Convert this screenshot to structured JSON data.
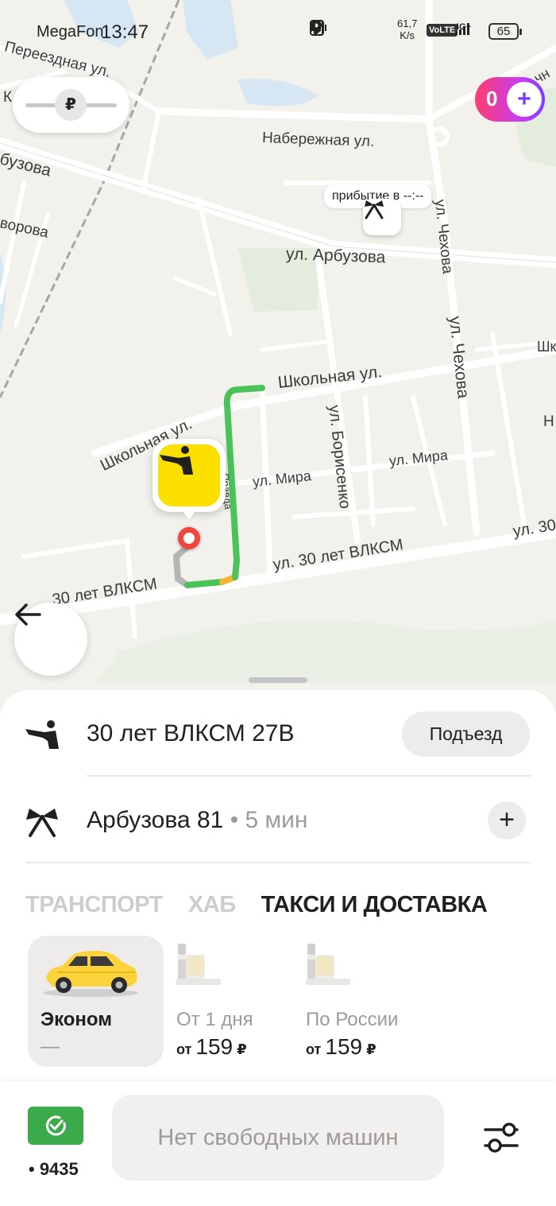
{
  "status_bar": {
    "carrier": "MegaFon",
    "time": "13:47",
    "speed_value": "61,7",
    "speed_unit": "K/s",
    "volte": "VoLTE",
    "network": "4G+",
    "battery": "65"
  },
  "map": {
    "price_toggle_symbol": "₽",
    "plus_count": "0",
    "arrival_text": "прибытие в --:--",
    "streets": {
      "pereezdnaya": "Переездная ул.",
      "naberezhnaya": "Набережная ул.",
      "arbuzova_left": "бузова",
      "arbuzova": "ул. Арбузова",
      "vorova": "ворова",
      "chekhova_top": "ул. Чехова",
      "chekhova": "ул. Чехова",
      "shkolnaya_right": "Школьная ул.",
      "shkolnaya_left": "Школьная ул.",
      "borisenko": "ул. Борисенко",
      "mira_right": "ул. Мира",
      "mira_mid": "ул. Мира",
      "pravda": "Правда",
      "vlksm_right": "ул. 30 лет ВЛКСМ",
      "vlksm_left": "30 лет ВЛКСМ",
      "vlksm_edge": "ул. 30",
      "edge_shk": "Шк",
      "edge_chn": "чн",
      "edge_n": "Н",
      "edge_k": "К"
    }
  },
  "route": {
    "pickup_address": "30 лет ВЛКСМ 27В",
    "entrance_label": "Подъезд",
    "destination_address": "Арбузова 81",
    "destination_eta": " • 5 мин",
    "add_stop_symbol": "+"
  },
  "tabs": [
    {
      "label": "ТРАНСПОРТ",
      "active": false
    },
    {
      "label": "ХАБ",
      "active": false
    },
    {
      "label": "ТАКСИ И ДОСТАВКА",
      "active": true
    }
  ],
  "tariffs": [
    {
      "name": "Эконом",
      "price_text": "—",
      "selected": true
    },
    {
      "name": "От 1 дня",
      "price_prefix": "от",
      "price_amount": "159",
      "currency": "₽",
      "selected": false
    },
    {
      "name": "По России",
      "price_prefix": "от",
      "price_amount": "159",
      "currency": "₽",
      "selected": false
    }
  ],
  "bottom": {
    "payment_number": "• 9435",
    "order_button": "Нет свободных машин"
  },
  "colors": {
    "accent_yellow": "#fce000",
    "route_green": "#4cc35a",
    "pickup_red": "#f2453d",
    "payment_green": "#3aaa4a"
  }
}
